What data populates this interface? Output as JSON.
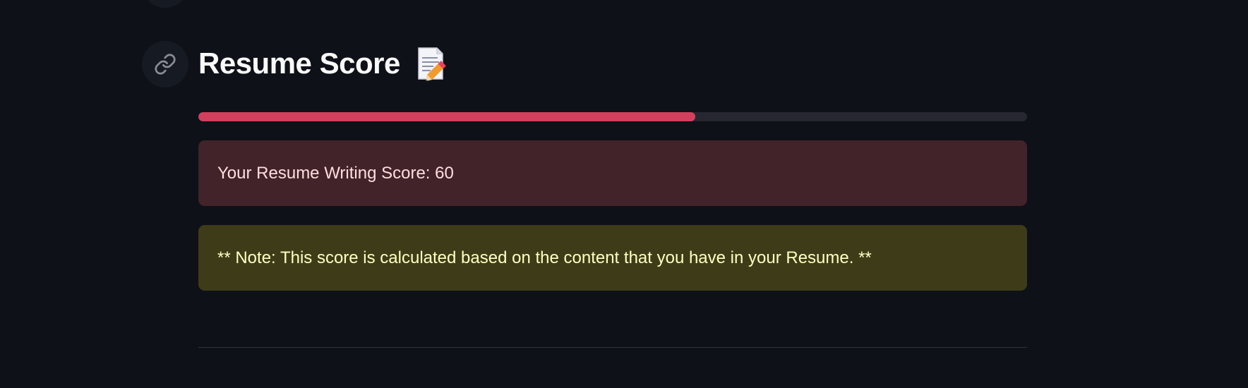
{
  "section": {
    "title": "Resume Score",
    "title_icon": "memo-icon",
    "anchor_icon": "link-icon"
  },
  "score_progress": {
    "value": 60,
    "max": 100,
    "fill_color": "#d2405d"
  },
  "score_alert": {
    "text": "Your Resume Writing Score: 60",
    "kind": "error"
  },
  "note_alert": {
    "text": "** Note: This score is calculated based on the content that you have in your Resume. **",
    "kind": "warning"
  },
  "colors": {
    "background": "#0e1117",
    "error_bg": "#42232a",
    "warning_bg": "#3e3c18"
  }
}
